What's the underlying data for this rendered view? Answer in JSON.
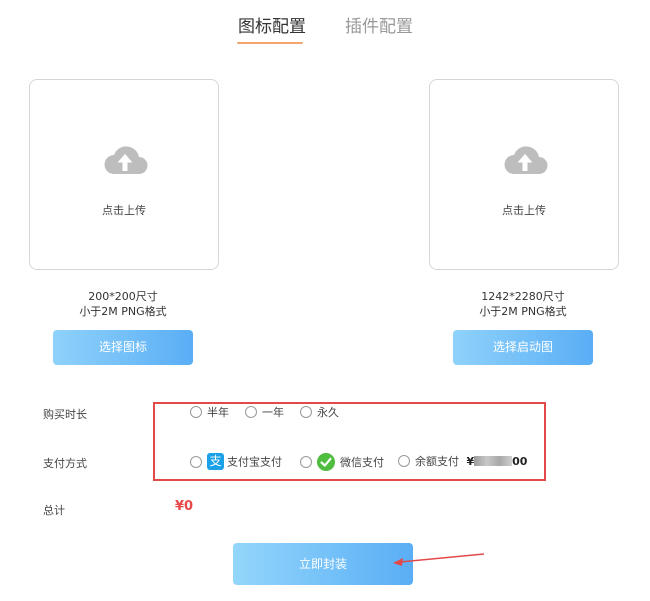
{
  "tabs": [
    {
      "label": "图标配置",
      "active": true
    },
    {
      "label": "插件配置",
      "active": false
    }
  ],
  "icon_upload": {
    "upload_label": "点击上传",
    "size_line": "200*200尺寸",
    "format_line": "小于2M PNG格式",
    "button_label": "选择图标"
  },
  "splash_upload": {
    "upload_label": "点击上传",
    "size_line": "1242*2280尺寸",
    "format_line": "小于2M PNG格式",
    "button_label": "选择启动图"
  },
  "duration": {
    "label": "购买时长",
    "options": [
      "半年",
      "一年",
      "永久"
    ]
  },
  "payment": {
    "label": "支付方式",
    "alipay_icon_glyph": "支",
    "options": [
      "支付宝支付",
      "微信支付",
      "余额支付"
    ],
    "balance_prefix": "¥",
    "balance_suffix": "00"
  },
  "total": {
    "label": "总计",
    "value": "¥0"
  },
  "submit_label": "立即封装",
  "colors": {
    "accent_underline": "#f2a66e",
    "button_gradient_start": "#8fd2fb",
    "button_gradient_end": "#5aaef5",
    "highlight_border": "#e24a4a",
    "total_value": "#e84747",
    "alipay": "#1aa1e8",
    "wechat": "#4fbd3e"
  },
  "icons": {
    "upload": "cloud-upload-icon",
    "alipay": "alipay-icon",
    "wechat": "wechat-pay-icon",
    "annotation": "red-arrow-annotation"
  }
}
